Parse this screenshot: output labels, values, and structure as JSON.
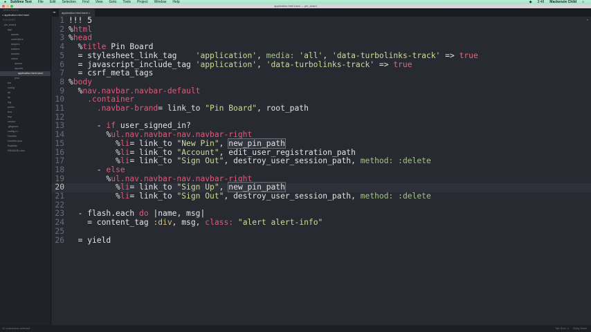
{
  "menubar": {
    "apple": "",
    "app": "Sublime Text",
    "items": [
      "File",
      "Edit",
      "Selection",
      "Find",
      "View",
      "Goto",
      "Tools",
      "Project",
      "Window",
      "Help"
    ],
    "clock": "3:48",
    "user": "Mackenzie Child"
  },
  "window": {
    "title": "application.html.haml — pin_board"
  },
  "sidebar": {
    "open_files_header": "OPEN FILES",
    "open_file": "application.html.haml",
    "folders_header": "FOLDERS",
    "tree": [
      {
        "label": "pin_board",
        "depth": 0
      },
      {
        "label": "app",
        "depth": 1
      },
      {
        "label": "assets",
        "depth": 2
      },
      {
        "label": "controllers",
        "depth": 2
      },
      {
        "label": "helpers",
        "depth": 2
      },
      {
        "label": "mailers",
        "depth": 2
      },
      {
        "label": "models",
        "depth": 2
      },
      {
        "label": "views",
        "depth": 2
      },
      {
        "label": "devise",
        "depth": 3
      },
      {
        "label": "layouts",
        "depth": 3
      },
      {
        "label": "application.html.haml",
        "depth": 4,
        "selected": true
      },
      {
        "label": "pins",
        "depth": 3
      },
      {
        "label": "bin",
        "depth": 1
      },
      {
        "label": "config",
        "depth": 1
      },
      {
        "label": "db",
        "depth": 1
      },
      {
        "label": "lib",
        "depth": 1
      },
      {
        "label": "log",
        "depth": 1
      },
      {
        "label": "public",
        "depth": 1
      },
      {
        "label": "test",
        "depth": 1
      },
      {
        "label": "tmp",
        "depth": 1
      },
      {
        "label": "vendor",
        "depth": 1
      },
      {
        "label": ".gitignore",
        "depth": 1
      },
      {
        "label": "config.ru",
        "depth": 1
      },
      {
        "label": "Gemfile",
        "depth": 1
      },
      {
        "label": "Gemfile.lock",
        "depth": 1
      },
      {
        "label": "Rakefile",
        "depth": 1
      },
      {
        "label": "README.rdoc",
        "depth": 1
      }
    ]
  },
  "tab": {
    "label": "application.html.haml"
  },
  "editor": {
    "current_line": 20,
    "lines": [
      [
        [
          "!!! 5",
          ""
        ]
      ],
      [
        [
          "%",
          "n"
        ],
        [
          "html",
          "t"
        ]
      ],
      [
        [
          "%",
          "n"
        ],
        [
          "head",
          "t"
        ]
      ],
      [
        [
          "  %",
          "n"
        ],
        [
          "title",
          "t"
        ],
        [
          " Pin Board",
          ""
        ]
      ],
      [
        [
          "  = stylesheet_link_tag    ",
          ""
        ],
        [
          "'application'",
          "s"
        ],
        [
          ", ",
          ""
        ],
        [
          "media:",
          "sy"
        ],
        [
          " ",
          ""
        ],
        [
          "'all'",
          "s"
        ],
        [
          ", ",
          ""
        ],
        [
          "'data-turbolinks-track'",
          "s"
        ],
        [
          " => ",
          ""
        ],
        [
          "true",
          "b"
        ]
      ],
      [
        [
          "  = javascript_include_tag ",
          ""
        ],
        [
          "'application'",
          "s"
        ],
        [
          ", ",
          ""
        ],
        [
          "'data-turbolinks-track'",
          "s"
        ],
        [
          " => ",
          ""
        ],
        [
          "true",
          "b"
        ]
      ],
      [
        [
          "  = csrf_meta_tags",
          ""
        ]
      ],
      [
        [
          "%",
          "n"
        ],
        [
          "body",
          "t"
        ]
      ],
      [
        [
          "  %",
          "n"
        ],
        [
          "nav.navbar.navbar-default",
          "t"
        ]
      ],
      [
        [
          "    ",
          ""
        ],
        [
          ".container",
          "t"
        ]
      ],
      [
        [
          "      ",
          ""
        ],
        [
          ".navbar-brand",
          "t"
        ],
        [
          "= link_to ",
          ""
        ],
        [
          "\"Pin Board\"",
          "s"
        ],
        [
          ", root_path",
          ""
        ]
      ],
      [
        [
          "",
          ""
        ]
      ],
      [
        [
          "      - ",
          ""
        ],
        [
          "if",
          "k"
        ],
        [
          " user_signed_in?",
          ""
        ]
      ],
      [
        [
          "        %",
          "n"
        ],
        [
          "ul.nav.navbar-nav.navbar-right",
          "t"
        ]
      ],
      [
        [
          "          %",
          "n"
        ],
        [
          "li",
          "t"
        ],
        [
          "= link_to ",
          ""
        ],
        [
          "\"New Pin\"",
          "s"
        ],
        [
          ", ",
          ""
        ],
        [
          "new_pin_path",
          "box"
        ]
      ],
      [
        [
          "          %",
          "n"
        ],
        [
          "li",
          "t"
        ],
        [
          "= link_to ",
          ""
        ],
        [
          "\"Account\"",
          "s"
        ],
        [
          ", edit_user_registration_path",
          ""
        ]
      ],
      [
        [
          "          %",
          "n"
        ],
        [
          "li",
          "t"
        ],
        [
          "= link_to ",
          ""
        ],
        [
          "\"Sign Out\"",
          "s"
        ],
        [
          ", destroy_user_session_path, ",
          ""
        ],
        [
          "method:",
          "sy"
        ],
        [
          " ",
          ""
        ],
        [
          ":delete",
          "sy"
        ]
      ],
      [
        [
          "      - ",
          ""
        ],
        [
          "else",
          "k"
        ]
      ],
      [
        [
          "        %",
          "n"
        ],
        [
          "ul.nav.navbar-nav.navbar-right",
          "t"
        ]
      ],
      [
        [
          "          %",
          "n"
        ],
        [
          "li",
          "t"
        ],
        [
          "= link_to ",
          ""
        ],
        [
          "\"Sign Up\"",
          "s"
        ],
        [
          ", ",
          ""
        ],
        [
          "new_pin_path",
          "box"
        ]
      ],
      [
        [
          "          %",
          "n"
        ],
        [
          "li",
          "t"
        ],
        [
          "= link_to ",
          ""
        ],
        [
          "\"Sign Out\"",
          "s"
        ],
        [
          ", destroy_user_session_path, ",
          ""
        ],
        [
          "method:",
          "sy"
        ],
        [
          " ",
          ""
        ],
        [
          ":delete",
          "sy"
        ]
      ],
      [
        [
          "",
          ""
        ]
      ],
      [
        [
          "  - flash.each ",
          ""
        ],
        [
          "do",
          "k"
        ],
        [
          " |name, msg|",
          ""
        ]
      ],
      [
        [
          "    = content_tag ",
          ""
        ],
        [
          ":div",
          "y"
        ],
        [
          ", msg, ",
          ""
        ],
        [
          "class:",
          "k"
        ],
        [
          " ",
          ""
        ],
        [
          "\"alert alert-info\"",
          "s"
        ]
      ],
      [
        [
          "",
          ""
        ]
      ],
      [
        [
          "  = yield",
          ""
        ]
      ]
    ]
  },
  "statusbar": {
    "left": "12 characters selected",
    "indent": "Tab Size: 2",
    "syntax": "Ruby Haml"
  },
  "colors": {
    "tag": "#df5b79",
    "string": "#cfdc95",
    "symbol": "#a8c487",
    "background": "#282a32"
  }
}
